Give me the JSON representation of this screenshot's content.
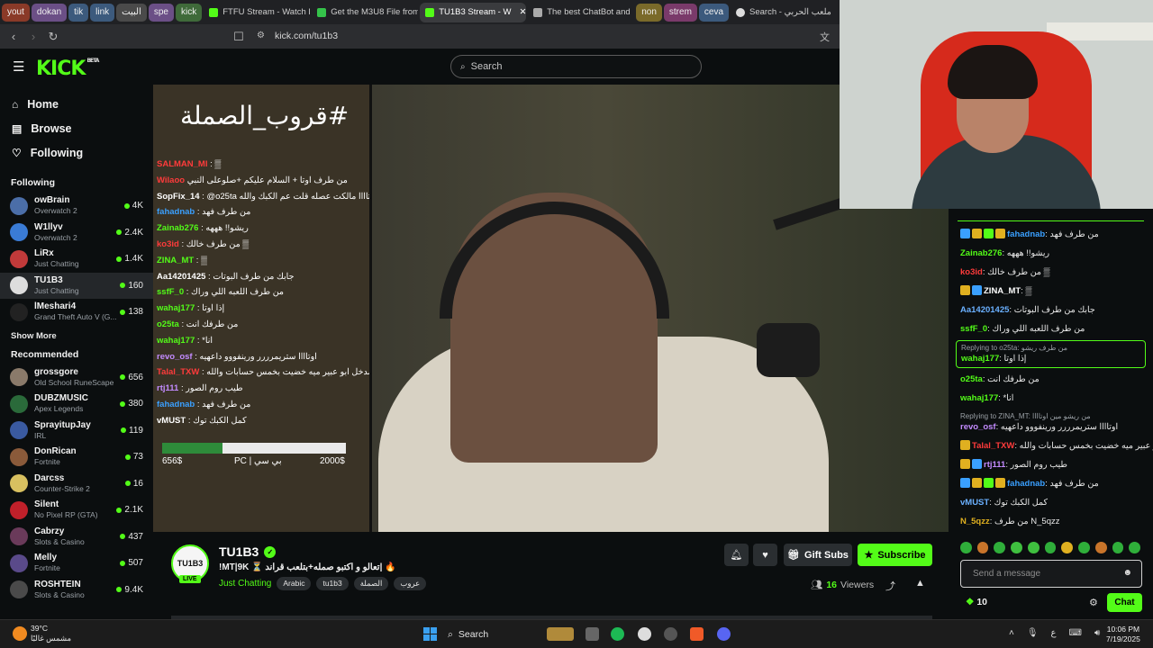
{
  "browser": {
    "pinned_tabs": [
      {
        "label": "yout",
        "color": "#8a3a28"
      },
      {
        "label": "dokan",
        "color": "#6b4f86"
      },
      {
        "label": "tik",
        "color": "#3c5a7d"
      },
      {
        "label": "link",
        "color": "#3c5a7d"
      },
      {
        "label": "البيت",
        "color": "#4a4a4a"
      },
      {
        "label": "spe",
        "color": "#6b4f86"
      },
      {
        "label": "kick",
        "color": "#3f6a3a"
      }
    ],
    "tabs": [
      {
        "label": "FTFU Stream - Watch L",
        "color": "#53fc18",
        "active": false
      },
      {
        "label": "Get the M3U8 File from",
        "color": "#35c34a",
        "active": false
      },
      {
        "label": "TU1B3 Stream - W",
        "color": "#53fc18",
        "active": true
      },
      {
        "label": "The best ChatBot and",
        "color": "#aaaaaa",
        "active": false
      }
    ],
    "tail_pills": [
      {
        "label": "non",
        "color": "#7a6a2a"
      },
      {
        "label": "strem",
        "color": "#7a3a6a"
      },
      {
        "label": "ceva",
        "color": "#3c5a7d"
      }
    ],
    "last_tab": "Search - ملعب الحربي",
    "url": "kick.com/tu1b3"
  },
  "kick": {
    "logo": "KICK",
    "logo_sup": "BETA",
    "search_placeholder": "Search",
    "nav": [
      {
        "label": "Home",
        "icon": "home-icon",
        "glyph": "⌂"
      },
      {
        "label": "Browse",
        "icon": "browse-icon",
        "glyph": "▤"
      },
      {
        "label": "Following",
        "icon": "heart-icon",
        "glyph": "♡"
      }
    ],
    "following_heading": "Following",
    "following": [
      {
        "name": "owBrain",
        "game": "Overwatch 2",
        "viewers": "4K",
        "color": "#4b6ea8"
      },
      {
        "name": "W1llyv",
        "game": "Overwatch 2",
        "viewers": "2.4K",
        "color": "#3a7bd5"
      },
      {
        "name": "LiRx",
        "game": "Just Chatting",
        "viewers": "1.4K",
        "color": "#c23a3a"
      },
      {
        "name": "TU1B3",
        "game": "Just Chatting",
        "viewers": "160",
        "color": "#dddddd"
      },
      {
        "name": "lMeshari4",
        "game": "Grand Theft Auto V (G...",
        "viewers": "138",
        "color": "#222222"
      }
    ],
    "show_more": "Show More",
    "recommended_heading": "Recommended",
    "recommended": [
      {
        "name": "grossgore",
        "game": "Old School RuneScape",
        "viewers": "656",
        "color": "#8a7a6a"
      },
      {
        "name": "DUBZMUSIC",
        "game": "Apex Legends",
        "viewers": "380",
        "color": "#2a6a3a"
      },
      {
        "name": "SprayitupJay",
        "game": "IRL",
        "viewers": "119",
        "color": "#3a5aa0"
      },
      {
        "name": "DonRican",
        "game": "Fortnite",
        "viewers": "73",
        "color": "#8a5a3a"
      },
      {
        "name": "Darcss",
        "game": "Counter-Strike 2",
        "viewers": "16",
        "color": "#d8c060"
      },
      {
        "name": "Silent",
        "game": "No Pixel RP (GTA)",
        "viewers": "2.1K",
        "color": "#c0202a"
      },
      {
        "name": "Cabrzy",
        "game": "Slots & Casino",
        "viewers": "437",
        "color": "#6a3a5a"
      },
      {
        "name": "Melly",
        "game": "Fortnite",
        "viewers": "507",
        "color": "#5a4a8a"
      },
      {
        "name": "ROSHTEIN",
        "game": "Slots & Casino",
        "viewers": "9.4K",
        "color": "#4a4a4a"
      }
    ]
  },
  "video": {
    "overlay_title": "#قروب_الصملة",
    "overlay_chat": [
      {
        "user": "SALMAN_MI",
        "text": " : ▒",
        "color": "#ff3b3b"
      },
      {
        "user": "Wilaoo",
        "text": " من طرف اوتا + السلام عليكم +صلوعلى النبي",
        "color": "#ff3b3b"
      },
      {
        "user": "SopFix_14",
        "text": " : @o25ta اوتاااا مالكت عصله قلت عم الكبك والله",
        "color": "#ffffff"
      },
      {
        "user": "fahadnab",
        "text": " : من طرف فهد",
        "color": "#3aa0ff"
      },
      {
        "user": "Zainab276",
        "text": " : ريشو!! هههه",
        "color": "#53fc18"
      },
      {
        "user": "ko3id",
        "text": " : من طرف خالك ▒",
        "color": "#ff3b3b"
      },
      {
        "user": "ZINA_MT",
        "text": " : ▒",
        "color": "#53fc18"
      },
      {
        "user": "Aa14201425",
        "text": " : جابك من طرف البوتات",
        "color": "#ffffff"
      },
      {
        "user": "ssfF_0",
        "text": " : من طرف اللعبه اللي وراك",
        "color": "#53fc18"
      },
      {
        "user": "wahaj177",
        "text": " : إذا اوتا",
        "color": "#53fc18"
      },
      {
        "user": "o25ta",
        "text": " : من طرفك انت",
        "color": "#53fc18"
      },
      {
        "user": "wahaj177",
        "text": " : *انا",
        "color": "#53fc18"
      },
      {
        "user": "revo_osf",
        "text": " : اوتاااا ستريمرررر ورينفووو داعهيه",
        "color": "#c38bff"
      },
      {
        "user": "Talal_TXW",
        "text": " : قروب انا مدخل ابو عبير ميه خضيت بخمس حسابات والله",
        "color": "#ff3b3b"
      },
      {
        "user": "rtj111",
        "text": " : طيب روم الصور",
        "color": "#c38bff"
      },
      {
        "user": "fahadnab",
        "text": " : من طرف فهد",
        "color": "#3aa0ff"
      },
      {
        "user": "vMUST",
        "text": " : كمل الكبك توك",
        "color": "#ffffff"
      }
    ],
    "goal": {
      "left": "656$",
      "middle": "PC | بي سي",
      "right": "2000$",
      "progress": 0.33
    }
  },
  "channel": {
    "avatar_text": "TU1B3",
    "live": "LIVE",
    "name": "TU1B3",
    "title": "!MT|9K ⏳ تعالو و اكتبو صمله+بتلعب قراند| 🔥",
    "category": "Just Chatting",
    "tags": [
      "Arabic",
      "tu1b3",
      "الصملة",
      "عروب"
    ],
    "gift_label": "Gift Subs",
    "subscribe_label": "Subscribe",
    "viewers": "16",
    "viewers_label": "Viewers"
  },
  "chat": {
    "messages": [
      {
        "user": "fahadnab",
        "text": ": من طرف فهد",
        "color": "#3aa0ff",
        "badges": [
          "#3aa0ff",
          "#e0b020",
          "#53fc18",
          "#e0b020"
        ]
      },
      {
        "user": "Zainab276",
        "text": ": ريشو!! هههه",
        "color": "#53fc18",
        "badges": []
      },
      {
        "user": "ko3id",
        "text": ": من طرف خالك ▒",
        "color": "#ff3b3b",
        "badges": []
      },
      {
        "user": "ZINA_MT",
        "text": ": ▒",
        "color": "#ffffff",
        "badges": [
          "#e0b020",
          "#3aa0ff"
        ]
      },
      {
        "user": "Aa14201425",
        "text": ": جابك من طرف البوتات",
        "color": "#6ab0ff",
        "badges": []
      },
      {
        "user": "ssfF_0",
        "text": ": من طرف اللعبه اللي وراك",
        "color": "#53fc18",
        "badges": []
      }
    ],
    "reply_box": {
      "note": "Replying to o25ta: من طرف ريشو",
      "user": "wahaj177",
      "text": ": إذا اوتا"
    },
    "messages2": [
      {
        "user": "o25ta",
        "text": ": من طرفك انت",
        "color": "#53fc18",
        "badges": []
      },
      {
        "user": "wahaj177",
        "text": ": *انا",
        "color": "#53fc18",
        "badges": []
      }
    ],
    "reply2": {
      "note": "Replying to ZINA_MT: من ريشو مين اوتاااا",
      "user": "revo_osf",
      "text": ": اوتاااا ستريمرررر ورينفووو داعهيه"
    },
    "messages3": [
      {
        "user": "Talal_TXW",
        "text": ": قروب انا مدخل ابو عبير ميه خضيت بخمس حسابات والله",
        "color": "#ff3b3b",
        "badges": [
          "#e0b020"
        ]
      },
      {
        "user": "rtj111",
        "text": ": طيب روم الصور",
        "color": "#c38bff",
        "badges": [
          "#e0b020",
          "#3aa0ff"
        ]
      },
      {
        "user": "fahadnab",
        "text": ": من طرف فهد",
        "color": "#3aa0ff",
        "badges": [
          "#3aa0ff",
          "#e0b020",
          "#53fc18",
          "#e0b020"
        ]
      },
      {
        "user": "vMUST",
        "text": ": كمل الكبك توك",
        "color": "#6ab0ff",
        "badges": []
      },
      {
        "user": "N_5qzz",
        "text": ": من طرف N_5qzz",
        "color": "#e0b020",
        "badges": []
      }
    ],
    "input_placeholder": "Send a message",
    "points": "10",
    "send_label": "Chat"
  },
  "taskbar": {
    "temp": "39°C",
    "weather": "مشمس غالبًا",
    "search_label": "Search",
    "time": "10:06 PM",
    "date": "7/19/2025"
  },
  "colors": {
    "accent": "#53fc18",
    "bg": "#0b0e0f"
  }
}
